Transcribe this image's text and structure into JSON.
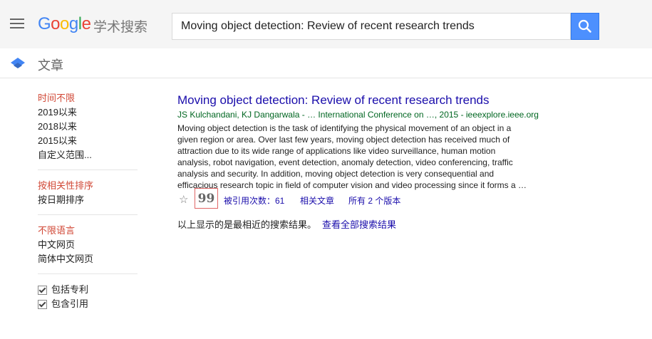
{
  "header": {
    "logo_parts": [
      "G",
      "o",
      "o",
      "g",
      "l",
      "e"
    ],
    "logo_sub": "学术搜索",
    "search_value": "Moving object detection: Review of recent research trends"
  },
  "subbar": {
    "title": "文章"
  },
  "sidebar": {
    "time": [
      "时间不限",
      "2019以来",
      "2018以来",
      "2015以来",
      "自定义范围..."
    ],
    "sort": [
      "按相关性排序",
      "按日期排序"
    ],
    "lang": [
      "不限语言",
      "中文网页",
      "简体中文网页"
    ],
    "checks": [
      "包括专利",
      "包含引用"
    ]
  },
  "result": {
    "title": "Moving object detection: Review of recent research trends",
    "meta": "JS Kulchandani, KJ Dangarwala - … International Conference on …, 2015 - ieeexplore.ieee.org",
    "snippet": [
      "Moving object detection is the task of identifying the physical movement of an object in a",
      "given region or area. Over last few years, moving object detection has received much of",
      "attraction due to its wide range of applications like video surveillance, human motion",
      "analysis, robot navigation, event detection, anomaly detection, video conferencing, traffic",
      "analysis and security. In addition, moving object detection is very consequential and",
      "efficacious research topic in field of computer vision and video processing since it forms a …"
    ],
    "cite_glyph": "99",
    "cited_by": "被引用次数：61",
    "related": "相关文章",
    "versions": "所有 2 个版本"
  },
  "footer": {
    "note": "以上显示的是最相近的搜索结果。",
    "link": "查看全部搜索结果"
  },
  "colors": {
    "accent": "#4d90fe",
    "link": "#1a0dab",
    "active": "#d14836",
    "meta": "#006621"
  }
}
